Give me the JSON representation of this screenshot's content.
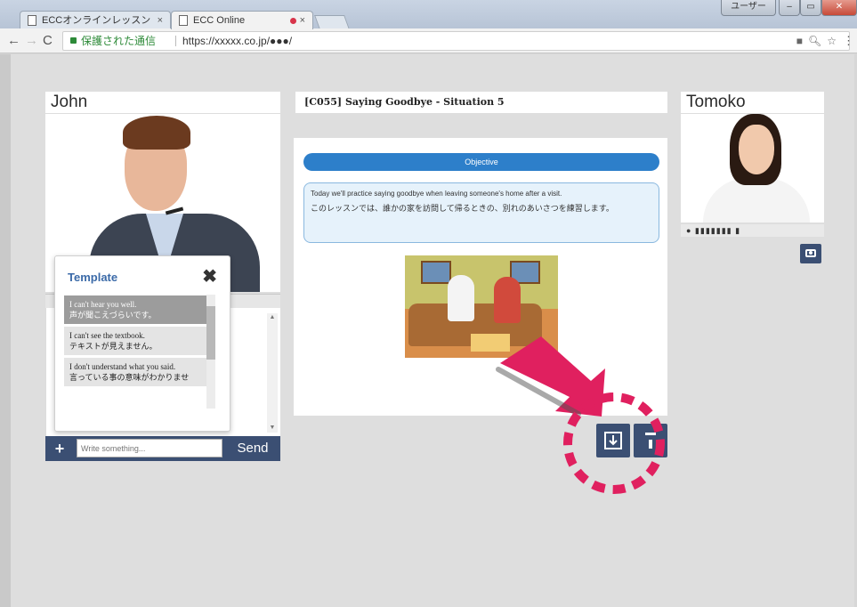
{
  "browser": {
    "tabs": [
      {
        "label": "ECCオンラインレッスン",
        "close": "×"
      },
      {
        "label": "ECC Online",
        "close": "×"
      }
    ],
    "secure_label": "保護された通信",
    "url": "https://xxxxx.co.jp/●●●/",
    "window_user_label": "ユーザー"
  },
  "student": {
    "name": "John"
  },
  "template": {
    "title": "Template",
    "close": "✖",
    "items": [
      {
        "en": "I can't hear you well.",
        "ja": "声が聞こえづらいです。"
      },
      {
        "en": "I can't see the textbook.",
        "ja": "テキストが見えません。"
      },
      {
        "en": "I don't understand what you said.",
        "ja": "言っている事の意味がわかりませ"
      }
    ]
  },
  "chat": {
    "plus": "+",
    "placeholder": "Write something...",
    "send_label": "Send"
  },
  "lesson": {
    "title": "[C055] Saying Goodbye - Situation 5",
    "objective_label": "Objective",
    "objective_en": "Today we'll practice saying goodbye when leaving someone's home after a visit.",
    "objective_ja": "このレッスンでは、誰かの家を訪問して帰るときの、別れのあいさつを練習します。"
  },
  "teacher": {
    "name": "Tomoko",
    "mic_level": "● ▮▮▮▮▮▮▮ ▮"
  },
  "colors": {
    "accent_blue": "#2d7fca",
    "button_navy": "#3b4f73",
    "annotation_pink": "#e0205f"
  },
  "icons": {
    "download": "download-icon",
    "camera": "camera-icon",
    "upload": "upload-icon"
  }
}
